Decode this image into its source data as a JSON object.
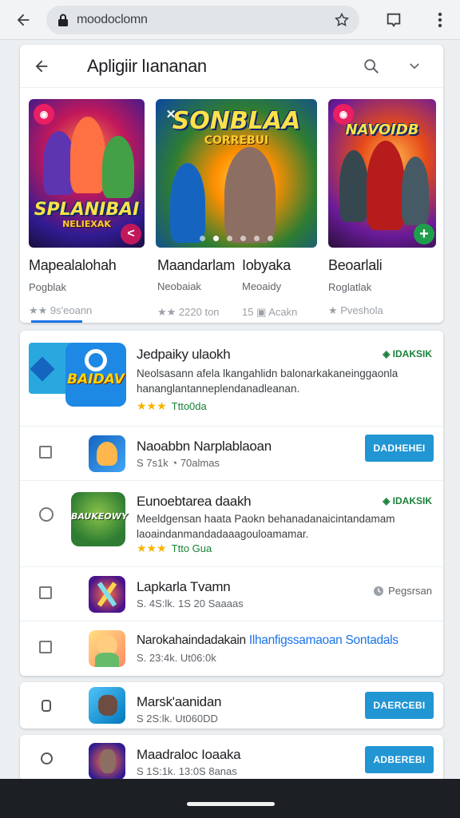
{
  "browser": {
    "url": "moodoclomn"
  },
  "featured": {
    "title": "Apligiir lıananan",
    "tiles": [
      {
        "name": "Mapealalohah",
        "dev": "Pogblak",
        "meta": "★★ 9s'eoann",
        "art_title": "SPLANIBAI",
        "art_sub": "NELIEXAK"
      },
      {
        "name": "Maandarlam",
        "name2": "Iobyaka",
        "dev": "Neobaiak",
        "dev2": "Meoaidy",
        "meta": "★★ 2220 ton",
        "meta2": "15 ▣ Acakn",
        "art_title": "SONBLAA",
        "art_sub": "CORREBUI"
      },
      {
        "name": "Beoarlali",
        "dev": "Roglatlak",
        "meta": "★ Pveshola",
        "art_title": "NAVOIDB",
        "art_sub": ""
      }
    ]
  },
  "list": {
    "rows": [
      {
        "name": "Jedpaiky ulaokh",
        "desc": "Neolsasann afela lkangahlidn balonarkakaneinggaonla hananglantanneplendanadleanan.",
        "stars": "★★★",
        "rating_label": "Ttto0da",
        "tag": "◈ IDAKSIK",
        "icon_text": "BAIDAV"
      },
      {
        "name": "Naoabbn Narplablaoan",
        "sub": "S 7s1k ◔ 70almas",
        "button": "DADHEHEI"
      },
      {
        "name": "Eunoebtarea daakh",
        "desc": "Meeldgensan haata Paokn behanadanaicintandamam laoaindanmandadaaagouloamamar.",
        "stars": "★★★",
        "rating_label": "Ttto Gua",
        "tag": "◈ IDAKSIK",
        "icon_text": "BAUKEOWY"
      },
      {
        "name": "Lapkarla Tvamn",
        "sub": "S. 4S:lk. 1S 20 Saaaas",
        "gray_tag": "Pegsrsan"
      },
      {
        "name": "Narokahaindadakain",
        "link": "Ilhanfigssamaoan Sontadals",
        "sub": "S. 23:4k. Ut06:0k"
      }
    ]
  },
  "extra": [
    {
      "name": "Marsk'aanidan",
      "sub": "S 2S:lk. Ut060DD",
      "button": "DAERCEBI"
    },
    {
      "name": "Maadraloc Ioaaka",
      "sub": "S 1S:1k. 13:0S 8anas",
      "button": "ADBEREBI"
    }
  ]
}
